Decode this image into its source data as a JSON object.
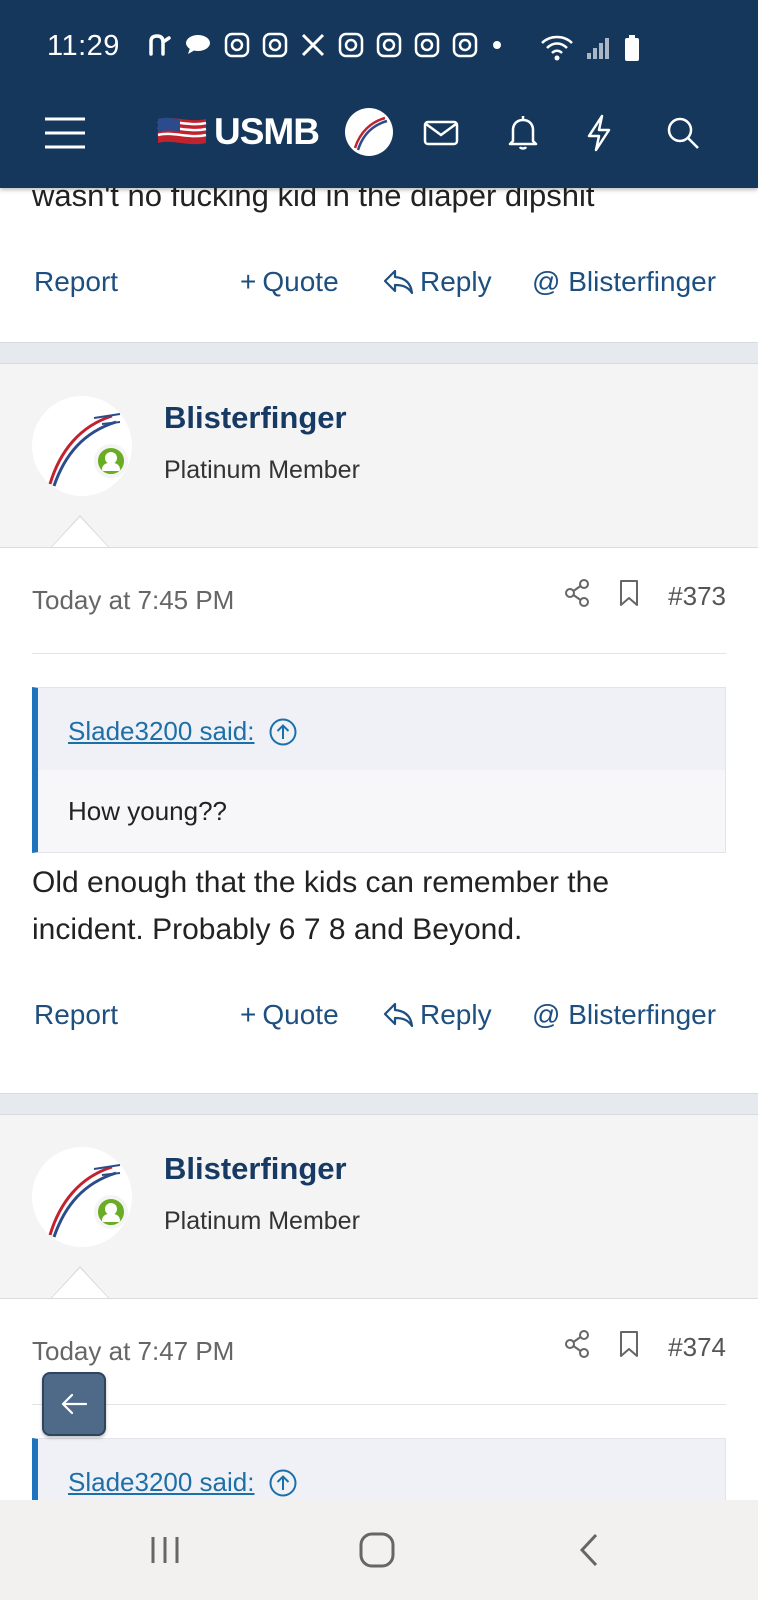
{
  "status_bar": {
    "time": "11:29",
    "notification_icons": [
      "n-app-icon",
      "chat-bubble-icon",
      "instagram-icon",
      "instagram-icon",
      "x-icon",
      "instagram-icon",
      "instagram-icon",
      "instagram-icon",
      "instagram-icon",
      "dot-icon"
    ],
    "system_icons": [
      "wifi-icon",
      "signal-icon",
      "battery-icon"
    ]
  },
  "app_bar": {
    "logo_text": "USMB",
    "icons": [
      "menu-icon",
      "mail-icon",
      "bell-icon",
      "lightning-icon",
      "search-icon"
    ],
    "background": "#15375c"
  },
  "previous_post": {
    "text": "wasn't no fucking kid in the diaper dipshit",
    "actions": {
      "report": "Report",
      "quote": "Quote",
      "reply": "Reply",
      "mention": "@ Blisterfinger"
    }
  },
  "posts": [
    {
      "username": "Blisterfinger",
      "user_title": "Platinum Member",
      "timestamp": "Today at 7:45 PM",
      "post_number": "#373",
      "quote": {
        "author": "Slade3200 said:",
        "text": "How young??"
      },
      "body_line1": "Old enough that the kids can remember the",
      "body_line2": "incident. Probably 6 7 8 and Beyond.",
      "actions": {
        "report": "Report",
        "quote": "Quote",
        "reply": "Reply",
        "mention": "@ Blisterfinger"
      }
    },
    {
      "username": "Blisterfinger",
      "user_title": "Platinum Member",
      "timestamp": "Today at 7:47 PM",
      "post_number": "#374",
      "quote": {
        "author": "Slade3200 said:"
      }
    }
  ],
  "colors": {
    "accent": "#1e73be",
    "link": "#1d4f80",
    "username": "#163a63",
    "online": "#6aac24"
  }
}
